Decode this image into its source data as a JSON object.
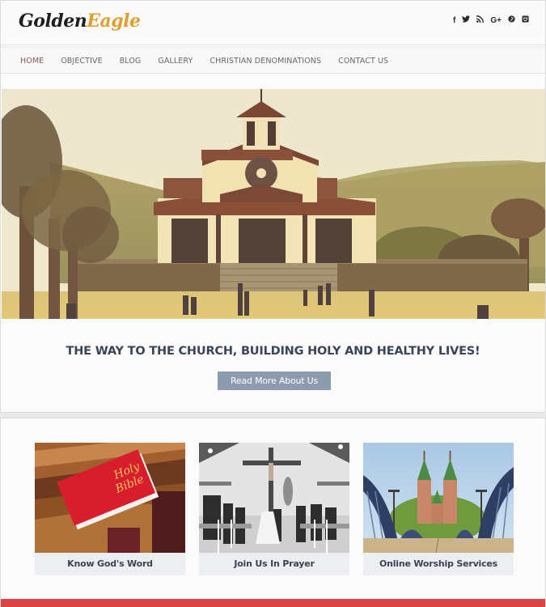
{
  "header": {
    "logo_part1": "Golden",
    "logo_part2": "Eagle",
    "logo_colors": {
      "part1": "#1f1f1f",
      "part2": "#e19f2e"
    },
    "social_icons": [
      {
        "name": "facebook-icon",
        "glyph": "f"
      },
      {
        "name": "twitter-icon",
        "glyph": "🐦"
      },
      {
        "name": "rss-icon",
        "glyph": "⟆"
      },
      {
        "name": "google-plus-icon",
        "glyph": "G+"
      },
      {
        "name": "pinterest-icon",
        "glyph": "℗"
      },
      {
        "name": "instagram-icon",
        "glyph": "◙"
      }
    ]
  },
  "nav": {
    "items": [
      {
        "label": "HOME",
        "active": true
      },
      {
        "label": "OBJECTIVE",
        "active": false
      },
      {
        "label": "BLOG",
        "active": false
      },
      {
        "label": "GALLERY",
        "active": false
      },
      {
        "label": "CHRISTIAN DENOMINATIONS",
        "active": false
      },
      {
        "label": "CONTACT US",
        "active": false
      }
    ],
    "active_color": "#8a5a48"
  },
  "hero": {
    "image_alt": "Church building with bell tower in front of mountains, people walking on the plaza"
  },
  "intro": {
    "tagline": "THE WAY TO THE CHURCH, BUILDING HOLY AND HEALTHY LIVES!",
    "button_label": "Read More About Us",
    "button_color": "#8c9bad"
  },
  "cards": [
    {
      "caption": "Know God's Word",
      "image_alt": "Red Holy Bible resting on a wooden pew"
    },
    {
      "caption": "Join Us In Prayer",
      "image_alt": "Black and white church wedding ceremony under a crucifix"
    },
    {
      "caption": "Online Worship Services",
      "image_alt": "Church with two green spires seen across a blue steel bridge"
    }
  ],
  "footer_bar_color": "#db4345"
}
